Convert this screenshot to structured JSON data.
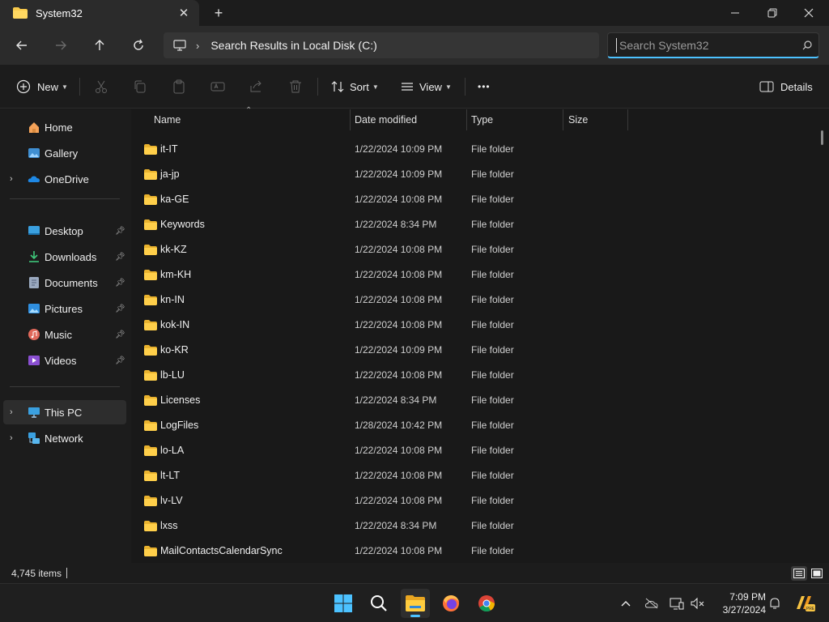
{
  "window": {
    "tab_title": "System32",
    "new_tab": "+",
    "minimize": "—",
    "close": "✕"
  },
  "address": {
    "crumb": "Search Results in Local Disk (C:)",
    "search_placeholder": "Search System32"
  },
  "toolbar": {
    "new_label": "New",
    "sort_label": "Sort",
    "view_label": "View",
    "more_label": "•••",
    "details_label": "Details"
  },
  "sidebar": {
    "top": [
      {
        "label": "Home",
        "icon": "home-icon"
      },
      {
        "label": "Gallery",
        "icon": "gallery-icon"
      },
      {
        "label": "OneDrive",
        "icon": "onedrive-icon"
      }
    ],
    "pinned": [
      {
        "label": "Desktop",
        "icon": "desktop-icon"
      },
      {
        "label": "Downloads",
        "icon": "downloads-icon"
      },
      {
        "label": "Documents",
        "icon": "documents-icon"
      },
      {
        "label": "Pictures",
        "icon": "pictures-icon"
      },
      {
        "label": "Music",
        "icon": "music-icon"
      },
      {
        "label": "Videos",
        "icon": "videos-icon"
      }
    ],
    "bottom": [
      {
        "label": "This PC",
        "icon": "this-pc-icon"
      },
      {
        "label": "Network",
        "icon": "network-icon"
      }
    ]
  },
  "columns": {
    "name": "Name",
    "date": "Date modified",
    "type": "Type",
    "size": "Size"
  },
  "files": [
    {
      "name": "it-IT",
      "date": "1/22/2024 10:09 PM",
      "type": "File folder"
    },
    {
      "name": "ja-jp",
      "date": "1/22/2024 10:09 PM",
      "type": "File folder"
    },
    {
      "name": "ka-GE",
      "date": "1/22/2024 10:08 PM",
      "type": "File folder"
    },
    {
      "name": "Keywords",
      "date": "1/22/2024 8:34 PM",
      "type": "File folder"
    },
    {
      "name": "kk-KZ",
      "date": "1/22/2024 10:08 PM",
      "type": "File folder"
    },
    {
      "name": "km-KH",
      "date": "1/22/2024 10:08 PM",
      "type": "File folder"
    },
    {
      "name": "kn-IN",
      "date": "1/22/2024 10:08 PM",
      "type": "File folder"
    },
    {
      "name": "kok-IN",
      "date": "1/22/2024 10:08 PM",
      "type": "File folder"
    },
    {
      "name": "ko-KR",
      "date": "1/22/2024 10:09 PM",
      "type": "File folder"
    },
    {
      "name": "lb-LU",
      "date": "1/22/2024 10:08 PM",
      "type": "File folder"
    },
    {
      "name": "Licenses",
      "date": "1/22/2024 8:34 PM",
      "type": "File folder"
    },
    {
      "name": "LogFiles",
      "date": "1/28/2024 10:42 PM",
      "type": "File folder"
    },
    {
      "name": "lo-LA",
      "date": "1/22/2024 10:08 PM",
      "type": "File folder"
    },
    {
      "name": "lt-LT",
      "date": "1/22/2024 10:08 PM",
      "type": "File folder"
    },
    {
      "name": "lv-LV",
      "date": "1/22/2024 10:08 PM",
      "type": "File folder"
    },
    {
      "name": "lxss",
      "date": "1/22/2024 8:34 PM",
      "type": "File folder"
    },
    {
      "name": "MailContactsCalendarSync",
      "date": "1/22/2024 10:08 PM",
      "type": "File folder"
    }
  ],
  "status": {
    "item_count": "4,745 items"
  },
  "taskbar": {
    "time": "7:09 PM",
    "date": "3/27/2024",
    "apps": [
      "start-icon",
      "search-icon",
      "file-explorer-icon",
      "firefox-icon",
      "chrome-icon"
    ]
  },
  "colors": {
    "accent": "#4cc2ff",
    "folder": "#f8c94b",
    "background": "#191919"
  }
}
